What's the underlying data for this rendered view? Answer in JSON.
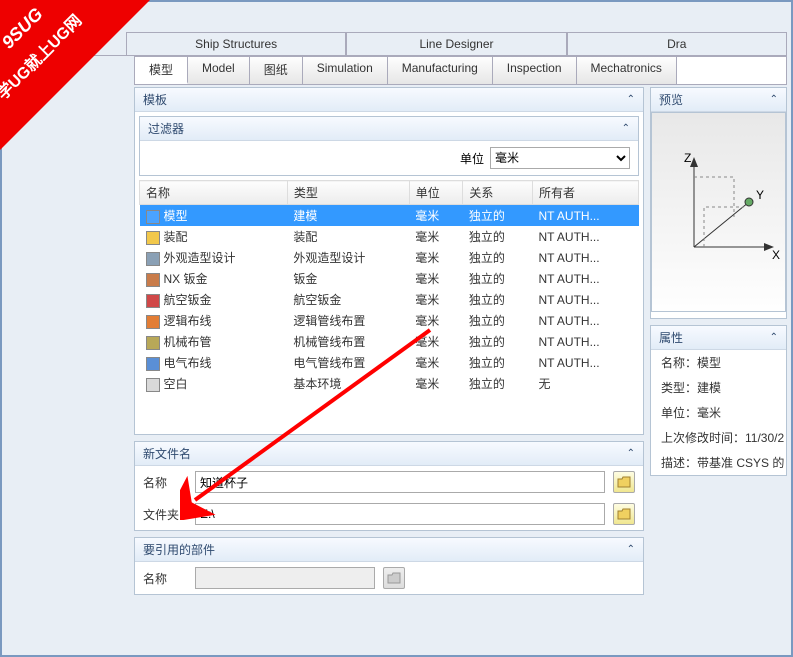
{
  "watermark": {
    "line1": "学UG就上UG网",
    "line2": "9SUG"
  },
  "topTabs": [
    "Ship Structures",
    "Line Designer",
    "Dra"
  ],
  "subTabs": [
    "模型",
    "Model",
    "图纸",
    "Simulation",
    "Manufacturing",
    "Inspection",
    "Mechatronics"
  ],
  "activeSubTab": 0,
  "templatePanel": {
    "title": "模板"
  },
  "filterPanel": {
    "title": "过滤器",
    "unitLabel": "单位",
    "unitValue": "毫米"
  },
  "tableHeaders": [
    "名称",
    "类型",
    "单位",
    "关系",
    "所有者"
  ],
  "rows": [
    {
      "icon": "#4aa3ff",
      "name": "模型",
      "type": "建模",
      "unit": "毫米",
      "rel": "独立的",
      "owner": "NT AUTH...",
      "sel": true
    },
    {
      "icon": "#f2c84b",
      "name": "装配",
      "type": "装配",
      "unit": "毫米",
      "rel": "独立的",
      "owner": "NT AUTH..."
    },
    {
      "icon": "#8aa0b5",
      "name": "外观造型设计",
      "type": "外观造型设计",
      "unit": "毫米",
      "rel": "独立的",
      "owner": "NT AUTH..."
    },
    {
      "icon": "#c97c4a",
      "name": "NX 钣金",
      "type": "钣金",
      "unit": "毫米",
      "rel": "独立的",
      "owner": "NT AUTH..."
    },
    {
      "icon": "#d04848",
      "name": "航空钣金",
      "type": "航空钣金",
      "unit": "毫米",
      "rel": "独立的",
      "owner": "NT AUTH..."
    },
    {
      "icon": "#e27d35",
      "name": "逻辑布线",
      "type": "逻辑管线布置",
      "unit": "毫米",
      "rel": "独立的",
      "owner": "NT AUTH..."
    },
    {
      "icon": "#b8a858",
      "name": "机械布管",
      "type": "机械管线布置",
      "unit": "毫米",
      "rel": "独立的",
      "owner": "NT AUTH..."
    },
    {
      "icon": "#5a8fd6",
      "name": "电气布线",
      "type": "电气管线布置",
      "unit": "毫米",
      "rel": "独立的",
      "owner": "NT AUTH..."
    },
    {
      "icon": "#d9d9d9",
      "name": "空白",
      "type": "基本环境",
      "unit": "毫米",
      "rel": "独立的",
      "owner": "无"
    }
  ],
  "newFile": {
    "title": "新文件名",
    "nameLabel": "名称",
    "nameValue": "知道杯子",
    "folderLabel": "文件夹",
    "folderValue": "E:\\"
  },
  "refPart": {
    "title": "要引用的部件",
    "nameLabel": "名称",
    "nameValue": ""
  },
  "preview": {
    "title": "预览"
  },
  "props": {
    "title": "属性",
    "lines": [
      "名称：模型",
      "类型：建模",
      "单位：毫米",
      "上次修改时间：11/30/2",
      "描述：带基准 CSYS 的 N"
    ]
  }
}
